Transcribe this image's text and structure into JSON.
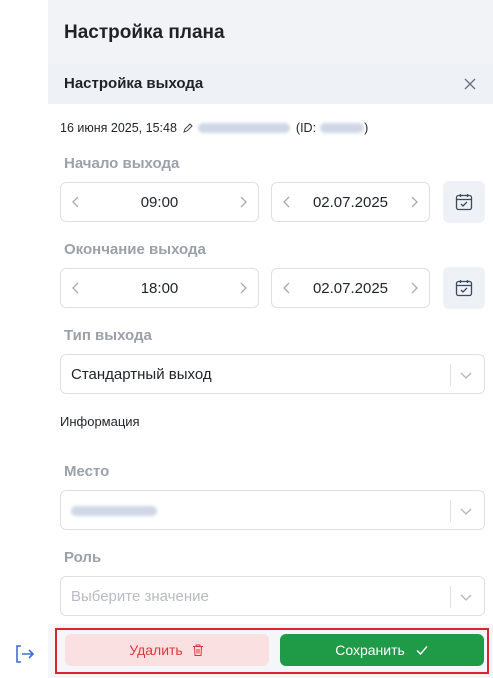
{
  "panel": {
    "title": "Настройка плана",
    "section_title": "Настройка выхода"
  },
  "meta": {
    "timestamp": "16 июня 2025, 15:48",
    "id_prefix": "(ID:",
    "id_suffix": ")"
  },
  "start": {
    "label": "Начало выхода",
    "time": "09:00",
    "date": "02.07.2025"
  },
  "end": {
    "label": "Окончание выхода",
    "time": "18:00",
    "date": "02.07.2025"
  },
  "shift_type": {
    "label": "Тип выхода",
    "value": "Стандартный выход"
  },
  "info": {
    "label": "Информация"
  },
  "place": {
    "label": "Место"
  },
  "role": {
    "label": "Роль",
    "placeholder": "Выберите значение"
  },
  "footer": {
    "delete_label": "Удалить",
    "save_label": "Сохранить"
  },
  "colors": {
    "accent_green": "#1f9a47",
    "danger_red": "#e3343b",
    "highlight_red": "#d9262a"
  },
  "icons": {
    "close": "close-icon",
    "edit": "pencil-icon",
    "calendar": "calendar-check-icon",
    "chevron_left": "chevron-left-icon",
    "chevron_right": "chevron-right-icon",
    "chevron_down": "chevron-down-icon",
    "trash": "trash-icon",
    "check": "check-icon",
    "logout": "logout-icon"
  }
}
